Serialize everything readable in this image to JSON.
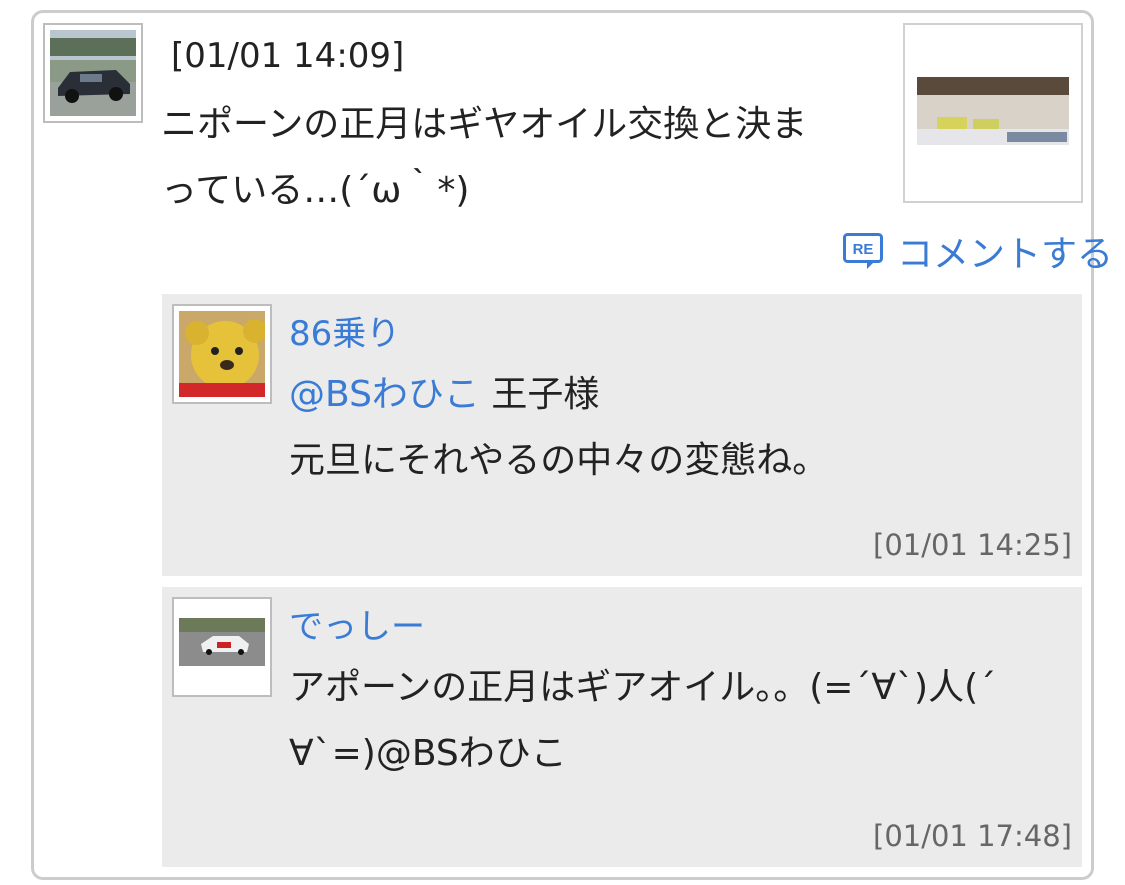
{
  "post": {
    "timestamp": "[01/01 14:09]",
    "body_line1": "ニポーンの正月はギヤオイル交換と決ま",
    "body_line2": "っている…(´ω｀*)",
    "comment_label": "コメントする"
  },
  "comments": [
    {
      "name": "86乗り",
      "mention": "@BSわひこ",
      "line1_rest": " 王子様",
      "line2": "元旦にそれやるの中々の変態ね。",
      "time": "[01/01 14:25]"
    },
    {
      "name": "でっしー",
      "line1": "アポーンの正月はギアオイル。。(=´∀`)人(´",
      "line2": "∀`=)@BSわひこ",
      "time": "[01/01 17:48]"
    }
  ],
  "colors": {
    "link": "#3a7bd5",
    "comment_bg": "#ebebeb",
    "border": "#cccccc"
  }
}
